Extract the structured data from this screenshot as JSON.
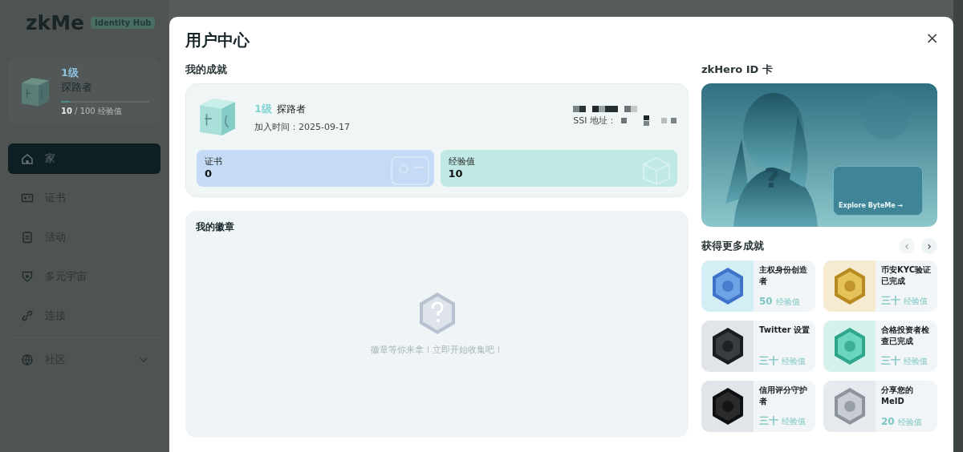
{
  "sidebar": {
    "logo": {
      "name": "zkMe",
      "tag": "Identity Hub"
    },
    "profile": {
      "level": "1级",
      "title": "探路者",
      "progress": {
        "level": 0.1
      },
      "progress_text": "**10** / 100 经验值"
    },
    "items": [
      {
        "label": "家",
        "selected": true
      },
      {
        "label": "证书",
        "selected": false
      },
      {
        "label": "活动",
        "selected": false
      },
      {
        "label": "多元宇宙",
        "selected": false
      },
      {
        "label": "连接",
        "selected": false
      }
    ],
    "community": {
      "label": "社区",
      "expanded": false
    }
  },
  "dialog": {
    "title": "用户中心",
    "close": "×",
    "achievements": {
      "heading": "我的成就",
      "level": "1级",
      "title": "探路者",
      "joined": "加入时间：2025-09-17",
      "ssi_label": "SSI 地址：",
      "stats": [
        {
          "label": "证书",
          "value": "0",
          "kind": "cert"
        },
        {
          "label": "经验值",
          "value": "10",
          "kind": "xp"
        }
      ]
    },
    "badges": {
      "heading": "我的徽章",
      "empty_text": "徽章等你来拿！立即开始收集吧！"
    },
    "id_card": {
      "heading": "zkHero ID 卡",
      "mark": "?",
      "link": "Explore ByteMe →"
    },
    "more": {
      "heading": "获得更多成就",
      "prev": {
        "label": "‹",
        "disabled": true
      },
      "next": {
        "label": "›",
        "disabled": false
      },
      "items": [
        {
          "name": "主权身份创造者",
          "points": "50",
          "unit": "经验值",
          "kind": "blue"
        },
        {
          "name": "币安KYC验证已完成",
          "points": "三十",
          "unit": "经验值",
          "kind": "gold"
        },
        {
          "name": "Twitter 设置",
          "points": "三十",
          "unit": "经验值",
          "kind": "x"
        },
        {
          "name": "合格投资者检查已完成",
          "points": "三十",
          "unit": "经验值",
          "kind": "teal"
        },
        {
          "name": "信用评分守护者",
          "points": "三十",
          "unit": "经验值",
          "kind": "dark"
        },
        {
          "name": "分享您的MeID",
          "points": "20",
          "unit": "经验值",
          "kind": "silver"
        }
      ]
    }
  }
}
